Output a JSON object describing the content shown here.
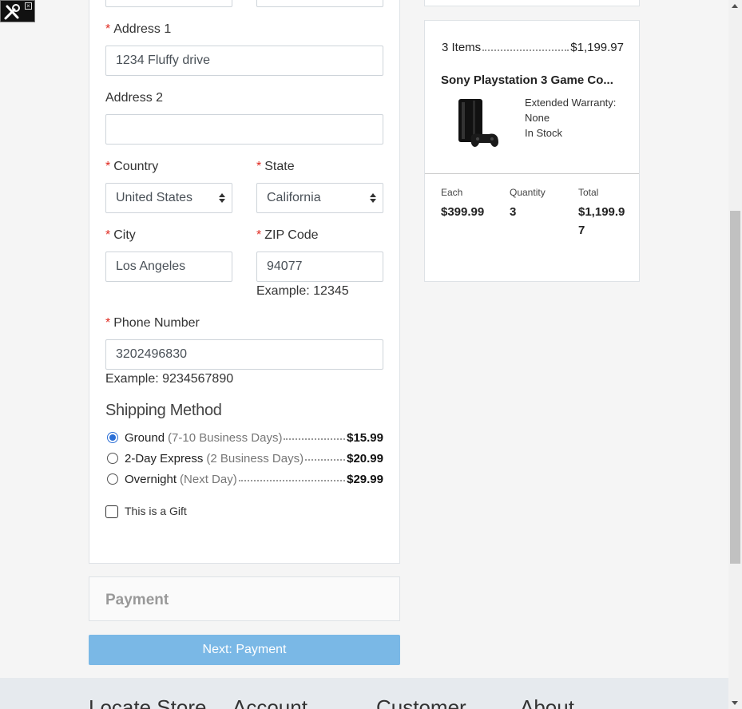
{
  "form": {
    "address1_label": "Address 1",
    "address1_value": "1234 Fluffy drive",
    "address2_label": "Address 2",
    "address2_value": "",
    "country_label": "Country",
    "country_value": "United States",
    "state_label": "State",
    "state_value": "California",
    "city_label": "City",
    "city_value": "Los Angeles",
    "zip_label": "ZIP Code",
    "zip_value": "94077",
    "zip_hint": "Example: 12345",
    "phone_label": "Phone Number",
    "phone_value": "3202496830",
    "phone_hint": "Example: 9234567890",
    "required_mark": "*"
  },
  "shipping": {
    "title": "Shipping Method",
    "options": [
      {
        "name": "Ground",
        "detail": "(7-10 Business Days)",
        "price": "$15.99",
        "selected": true
      },
      {
        "name": "2-Day Express",
        "detail": "(2 Business Days)",
        "price": "$20.99",
        "selected": false
      },
      {
        "name": "Overnight",
        "detail": "(Next Day)",
        "price": "$29.99",
        "selected": false
      }
    ],
    "gift_label": "This is a Gift",
    "gift_checked": false
  },
  "payment": {
    "title": "Payment",
    "next_button": "Next: Payment"
  },
  "summary": {
    "items_label": "3 Items",
    "items_total": "$1,199.97",
    "product_name": "Sony Playstation 3 Game Co...",
    "warranty": "Extended Warranty: None",
    "stock": "In Stock",
    "each_label": "Each",
    "each_value": "$399.99",
    "quantity_label": "Quantity",
    "quantity_value": "3",
    "total_label": "Total",
    "total_value": "$1,199.97"
  },
  "footer": {
    "items": [
      "Locate Store",
      "Account",
      "Customer",
      "About"
    ]
  },
  "colors": {
    "required": "#e0291f",
    "primary_button": "#7ab8e6",
    "radio_selected": "#2b6fd6"
  }
}
